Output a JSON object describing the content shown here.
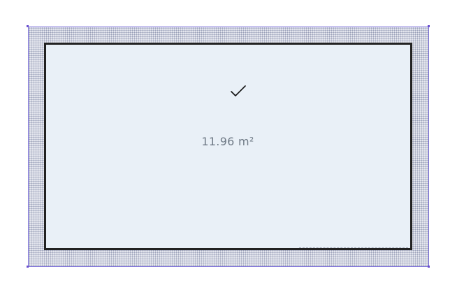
{
  "room": {
    "area_label": "11.96 m²",
    "status_icon": "checkmark-icon"
  },
  "colors": {
    "wall_border": "#7b6fd8",
    "room_fill": "#e9f0f7",
    "room_outline": "#222222",
    "area_text": "#6f7a86"
  }
}
